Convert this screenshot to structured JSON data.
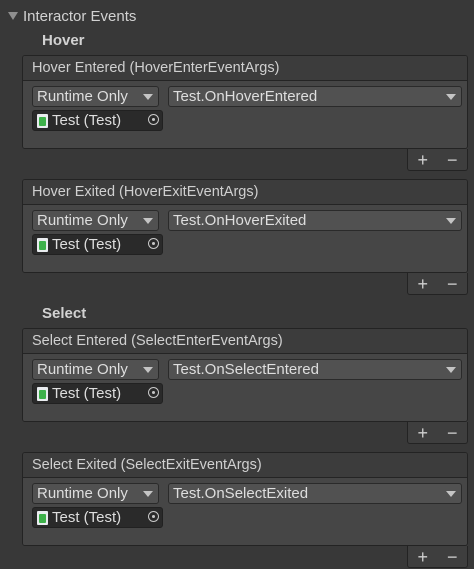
{
  "foldout": {
    "title": "Interactor Events"
  },
  "sections": [
    {
      "header": "Hover",
      "events": [
        {
          "title": "Hover Entered (HoverEnterEventArgs)",
          "mode": "Runtime Only",
          "function": "Test.OnHoverEntered",
          "object": "Test (Test)"
        },
        {
          "title": "Hover Exited (HoverExitEventArgs)",
          "mode": "Runtime Only",
          "function": "Test.OnHoverExited",
          "object": "Test (Test)"
        }
      ]
    },
    {
      "header": "Select",
      "events": [
        {
          "title": "Select Entered (SelectEnterEventArgs)",
          "mode": "Runtime Only",
          "function": "Test.OnSelectEntered",
          "object": "Test (Test)"
        },
        {
          "title": "Select Exited (SelectExitEventArgs)",
          "mode": "Runtime Only",
          "function": "Test.OnSelectExited",
          "object": "Test (Test)"
        }
      ]
    }
  ],
  "buttons": {
    "add": "+",
    "remove": "−"
  }
}
